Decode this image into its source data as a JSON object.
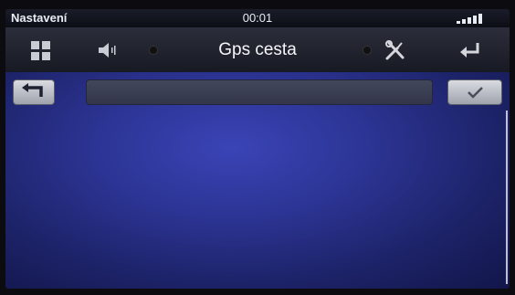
{
  "status_bar": {
    "title": "Nastavení",
    "time": "00:01"
  },
  "toolbar": {
    "title": "Gps cesta",
    "icons": [
      "apps-grid-icon",
      "volume-icon",
      "tools-icon",
      "return-icon"
    ]
  },
  "path_bar": {
    "current_path": ""
  },
  "colors": {
    "background_blue": "#2c3494",
    "toolbar_dark": "#22252f",
    "button_light": "#c9ccd3"
  }
}
